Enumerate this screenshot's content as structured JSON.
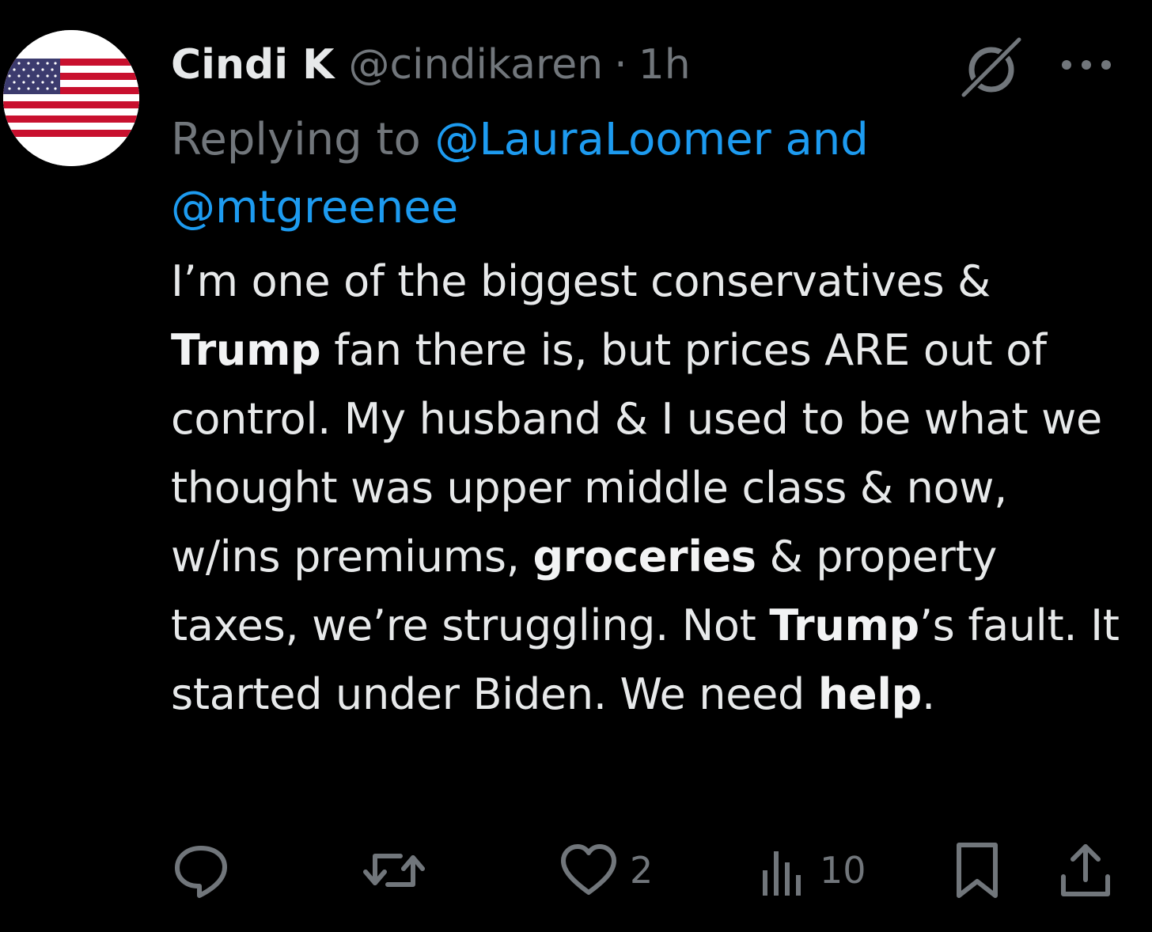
{
  "author": {
    "display_name": "Cindi K",
    "handle": "@cindikaren",
    "separator": "·",
    "time": "1h",
    "avatar": "us-flag-avatar"
  },
  "reply": {
    "prefix": "Replying to ",
    "mention_1": "@LauraLoomer",
    "connector": " and",
    "mention_2": "@mtgreenee"
  },
  "tweet": {
    "segments": [
      {
        "text": "I’m one of the biggest conservatives & ",
        "bold": false
      },
      {
        "text": "Trump",
        "bold": true
      },
      {
        "text": " fan there is, but prices ARE out of control. My husband & I used to be what we thought was upper middle class & now, w/ins premiums, ",
        "bold": false
      },
      {
        "text": "groceries",
        "bold": true
      },
      {
        "text": " & property taxes, we’re struggling. Not ",
        "bold": false
      },
      {
        "text": "Trump",
        "bold": true
      },
      {
        "text": "’s fault. It started under Biden. We need ",
        "bold": false
      },
      {
        "text": "help",
        "bold": true
      },
      {
        "text": ".",
        "bold": false
      }
    ]
  },
  "actions": {
    "reply_icon": "reply-icon",
    "retweet_icon": "retweet-icon",
    "like_icon": "heart-icon",
    "like_count": "2",
    "views_icon": "views-icon",
    "views_count": "10",
    "bookmark_icon": "bookmark-icon",
    "share_icon": "share-icon"
  },
  "colors": {
    "background": "#000000",
    "primary_text": "#e7e9ea",
    "secondary_text": "#71767b",
    "link": "#1d9bf0"
  }
}
